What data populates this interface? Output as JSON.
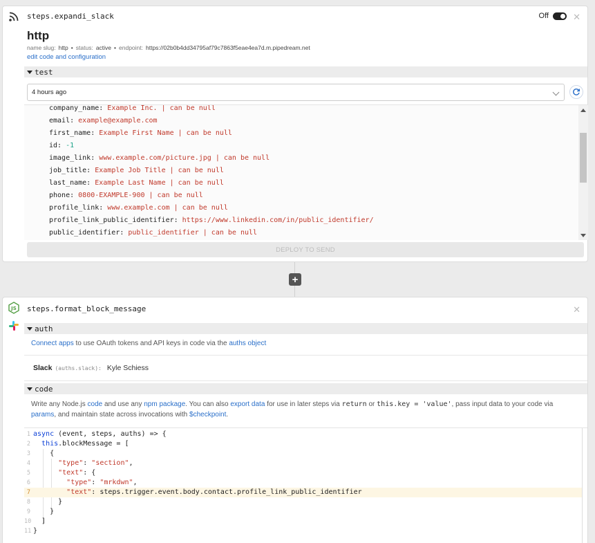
{
  "trigger": {
    "step_title": "steps.expandi_slack",
    "toggle_label": "Off",
    "name": "http",
    "meta": {
      "slug_label": "name slug:",
      "slug": "http",
      "status_label": "status:",
      "status": "active",
      "endpoint_label": "endpoint:",
      "endpoint": "https://02b0b4dd34795af79c7863f5eae4ea7d.m.pipedream.net"
    },
    "edit_link": "edit code and configuration",
    "test_label": "test",
    "selected_event": "4 hours ago",
    "data_lines": [
      {
        "key": "company_name:",
        "value": "Example Inc. | can be null"
      },
      {
        "key": "email:",
        "value": "example@example.com"
      },
      {
        "key": "first_name:",
        "value": "Example First Name | can be null"
      },
      {
        "key": "id:",
        "value": "-1",
        "numeric": true
      },
      {
        "key": "image_link:",
        "value": "www.example.com/picture.jpg | can be null"
      },
      {
        "key": "job_title:",
        "value": "Example Job Title | can be null"
      },
      {
        "key": "last_name:",
        "value": "Example Last Name | can be null"
      },
      {
        "key": "phone:",
        "value": "0800-EXAMPLE-900 | can be null"
      },
      {
        "key": "profile_link:",
        "value": "www.example.com | can be null"
      },
      {
        "key": "profile_link_public_identifier:",
        "value": "https://www.linkedin.com/in/public_identifier/"
      },
      {
        "key": "public_identifier:",
        "value": "public_identifier | can be null"
      }
    ],
    "deploy_button": "DEPLOY TO SEND"
  },
  "step": {
    "step_title": "steps.format_block_message",
    "auth_label": "auth",
    "auth_info": {
      "connect_link": "Connect apps",
      "middle": " to use OAuth tokens and API keys in code via the ",
      "auths_link": "auths object"
    },
    "slack": {
      "label": "Slack",
      "auth_key": "(auths.slack):",
      "account": "Kyle Schiess"
    },
    "code_label": "code",
    "description": {
      "p1": "Write any Node.js ",
      "l1": "code",
      "p2": " and use any ",
      "l2": "npm package",
      "p3": ". You can also ",
      "l3": "export data",
      "p4": " for use in later steps via ",
      "c1": "return",
      "p5": " or ",
      "c2": "this.key = 'value'",
      "p6": ", pass input data to your code via ",
      "l4": "params",
      "p7": ", and maintain state across invocations with ",
      "l5": "$checkpoint",
      "p8": "."
    },
    "code_lines": [
      "async (event, steps, auths) => {",
      "  this.blockMessage = [",
      "    {",
      "      \"type\": \"section\",",
      "      \"text\": {",
      "        \"type\": \"mrkdwn\",",
      "        \"text\": steps.trigger.event.body.contact.profile_link_public_identifier",
      "      }",
      "    }",
      "  ]",
      "}"
    ],
    "highlight_line": 7
  },
  "colors": {
    "accent": "#2a6fc9",
    "value_red": "#c0392b",
    "number_green": "#16a085",
    "highlight": "#fdf6e3"
  }
}
